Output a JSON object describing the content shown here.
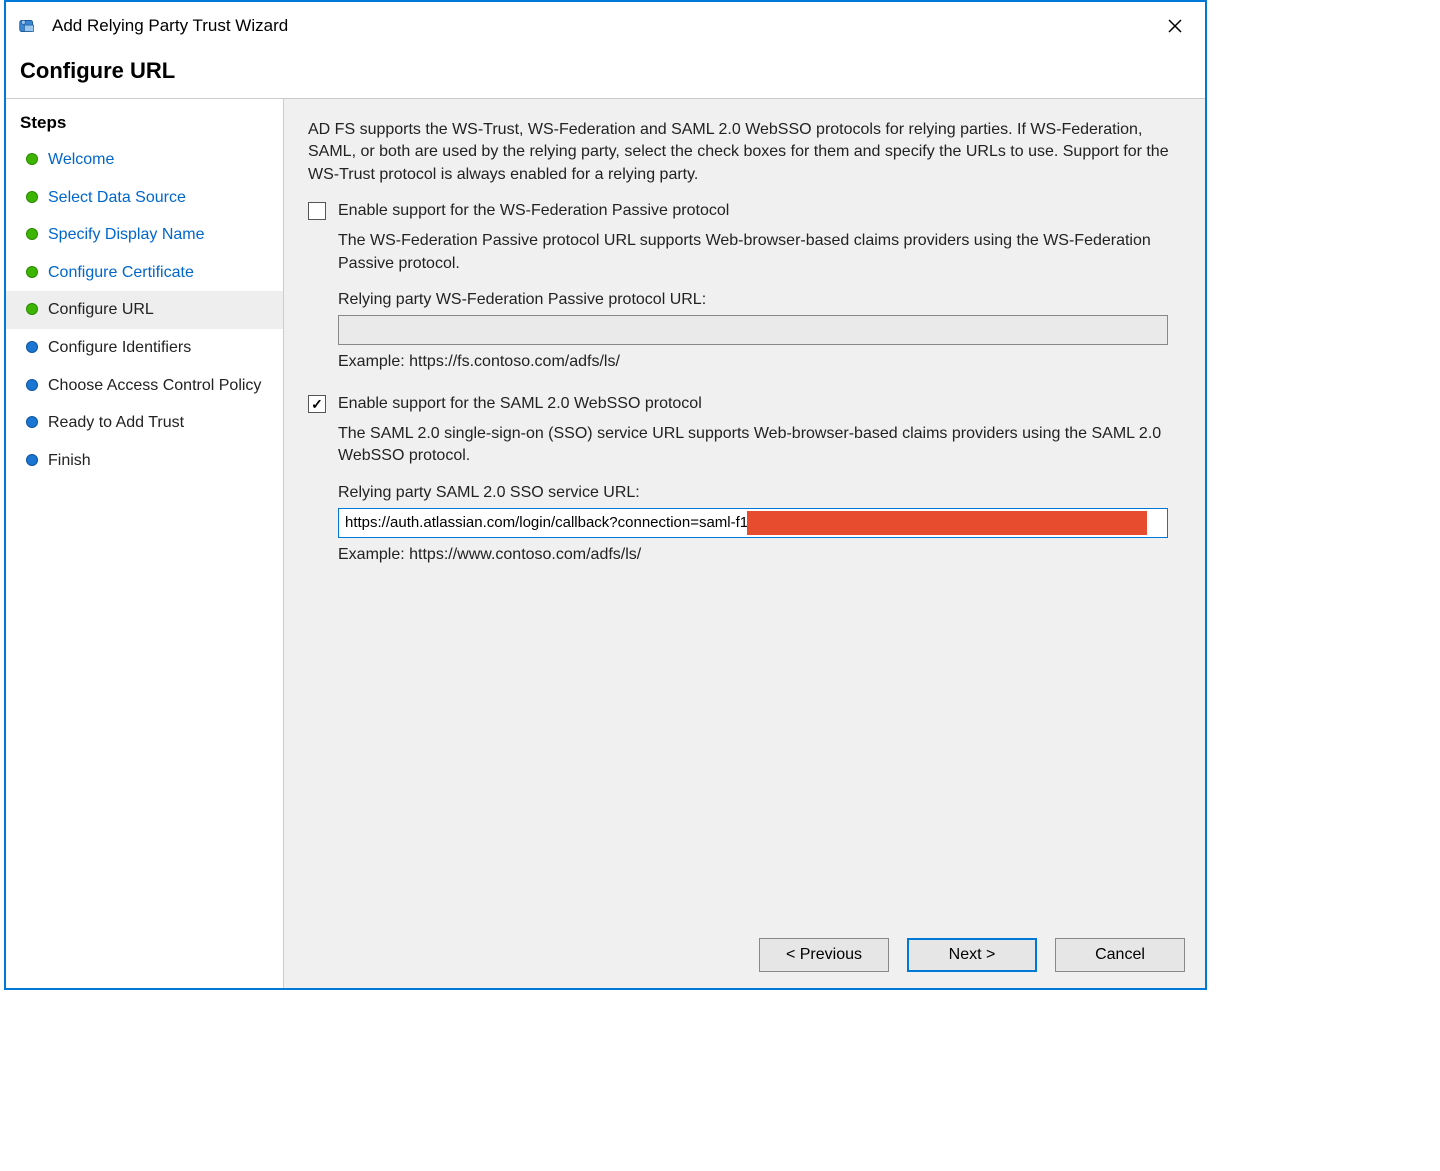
{
  "window": {
    "title": "Add Relying Party Trust Wizard"
  },
  "page": {
    "heading": "Configure URL"
  },
  "sidebar": {
    "heading": "Steps",
    "items": [
      {
        "label": "Welcome",
        "state": "done"
      },
      {
        "label": "Select Data Source",
        "state": "done"
      },
      {
        "label": "Specify Display Name",
        "state": "done"
      },
      {
        "label": "Configure Certificate",
        "state": "done"
      },
      {
        "label": "Configure URL",
        "state": "current"
      },
      {
        "label": "Configure Identifiers",
        "state": "upcoming"
      },
      {
        "label": "Choose Access Control Policy",
        "state": "upcoming"
      },
      {
        "label": "Ready to Add Trust",
        "state": "upcoming"
      },
      {
        "label": "Finish",
        "state": "upcoming"
      }
    ]
  },
  "content": {
    "intro": "AD FS supports the WS-Trust, WS-Federation and SAML 2.0 WebSSO protocols for relying parties.  If WS-Federation, SAML, or both are used by the relying party, select the check boxes for them and specify the URLs to use.  Support for the WS-Trust protocol is always enabled for a relying party.",
    "wsfed": {
      "checkbox_label": "Enable support for the WS-Federation Passive protocol",
      "checked": false,
      "description": "The WS-Federation Passive protocol URL supports Web-browser-based claims providers using the WS-Federation Passive protocol.",
      "url_label": "Relying party WS-Federation Passive protocol URL:",
      "url_value": "",
      "example": "Example: https://fs.contoso.com/adfs/ls/"
    },
    "saml": {
      "checkbox_label": "Enable support for the SAML 2.0 WebSSO protocol",
      "checked": true,
      "description": "The SAML 2.0 single-sign-on (SSO) service URL supports Web-browser-based claims providers using the SAML 2.0 WebSSO protocol.",
      "url_label": "Relying party SAML 2.0 SSO service URL:",
      "url_value": "https://auth.atlassian.com/login/callback?connection=saml-f10",
      "example": "Example: https://www.contoso.com/adfs/ls/"
    }
  },
  "buttons": {
    "previous": "< Previous",
    "next": "Next >",
    "cancel": "Cancel"
  }
}
